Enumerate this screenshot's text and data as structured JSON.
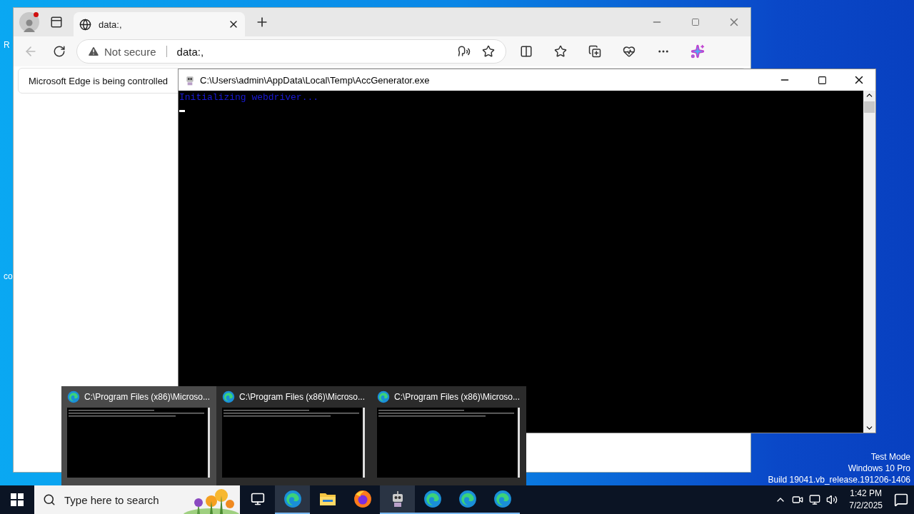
{
  "desktop": {
    "icon_labels": [
      "R",
      "co"
    ],
    "system_lines": [
      "Test Mode",
      "Windows 10 Pro",
      "Build 19041.vb_release.191206-1406"
    ]
  },
  "browser": {
    "tabs": [
      {
        "title": "data:,",
        "selected": true
      }
    ],
    "security": "Not secure",
    "url": "data:,",
    "infobar": "Microsoft Edge is being controlled"
  },
  "console": {
    "title": "C:\\Users\\admin\\AppData\\Local\\Temp\\AccGenerator.exe",
    "lines": [
      "Initializing webdriver..."
    ]
  },
  "thumbnails": [
    {
      "title": "C:\\Program Files (x86)\\Microso...",
      "selected": true
    },
    {
      "title": "C:\\Program Files (x86)\\Microso...",
      "selected": false
    },
    {
      "title": "C:\\Program Files (x86)\\Microso...",
      "selected": false
    }
  ],
  "taskbar": {
    "search_placeholder": "Type here to search",
    "apps": [
      {
        "kind": "edge",
        "running": true,
        "selected": true
      },
      {
        "kind": "explorer",
        "running": false,
        "selected": false
      },
      {
        "kind": "firefox",
        "running": false,
        "selected": false
      },
      {
        "kind": "robot",
        "running": true,
        "selected": true
      },
      {
        "kind": "edge",
        "running": true,
        "selected": false
      },
      {
        "kind": "edge",
        "running": true,
        "selected": false
      },
      {
        "kind": "edge",
        "running": true,
        "selected": false
      }
    ],
    "time": "1:42 PM",
    "date": "7/2/2025"
  }
}
